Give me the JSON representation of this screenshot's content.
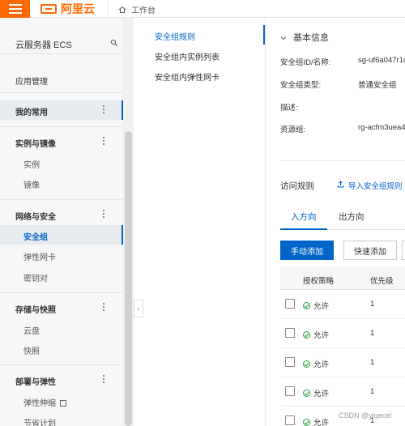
{
  "topbar": {
    "logo_text": "阿里云",
    "workbench_label": "工作台"
  },
  "sidebar": {
    "title": "云服务器 ECS",
    "items": [
      {
        "label": "应用管理",
        "type": "item"
      },
      {
        "label": "我的常用",
        "type": "group"
      },
      {
        "label": "实例与镜像",
        "type": "group"
      },
      {
        "label": "实例",
        "type": "sub"
      },
      {
        "label": "镜像",
        "type": "sub"
      },
      {
        "label": "网络与安全",
        "type": "group"
      },
      {
        "label": "安全组",
        "type": "sub",
        "active": true
      },
      {
        "label": "弹性网卡",
        "type": "sub"
      },
      {
        "label": "密钥对",
        "type": "sub"
      },
      {
        "label": "存储与快照",
        "type": "group"
      },
      {
        "label": "云盘",
        "type": "sub"
      },
      {
        "label": "快照",
        "type": "sub"
      },
      {
        "label": "部署与弹性",
        "type": "group"
      },
      {
        "label": "弹性伸缩",
        "type": "sub"
      },
      {
        "label": "节省计划",
        "type": "sub"
      }
    ]
  },
  "subnav": {
    "items": [
      "安全组规则",
      "安全组内实例列表",
      "安全组内弹性网卡"
    ],
    "active_index": 0
  },
  "basic_info": {
    "heading": "基本信息",
    "rows": [
      {
        "label": "安全组ID/名称:",
        "value": "sg-uf6a047r1c"
      },
      {
        "label": "安全组类型:",
        "value": "普通安全组"
      },
      {
        "label": "描述:",
        "value": ""
      },
      {
        "label": "资源组:",
        "value": "rg-acfm3uea4"
      }
    ]
  },
  "access_rules": {
    "title": "访问规则",
    "import_link": "导入安全组规则",
    "tabs": [
      "入方向",
      "出方向"
    ],
    "active_tab": 0,
    "buttons": {
      "manual_add": "手动添加",
      "quick_add": "快速添加"
    },
    "columns": [
      "授权策略",
      "优先级"
    ],
    "rows": [
      {
        "policy": "允许",
        "priority": "1"
      },
      {
        "policy": "允许",
        "priority": "1"
      },
      {
        "policy": "允许",
        "priority": "1"
      },
      {
        "policy": "允许",
        "priority": "1"
      },
      {
        "policy": "允许",
        "priority": "1"
      }
    ]
  },
  "watermark": "CSDN @yiqecel",
  "colors": {
    "brand": "#ff6a00",
    "accent": "#0064c8",
    "success": "#1e9e3a"
  }
}
